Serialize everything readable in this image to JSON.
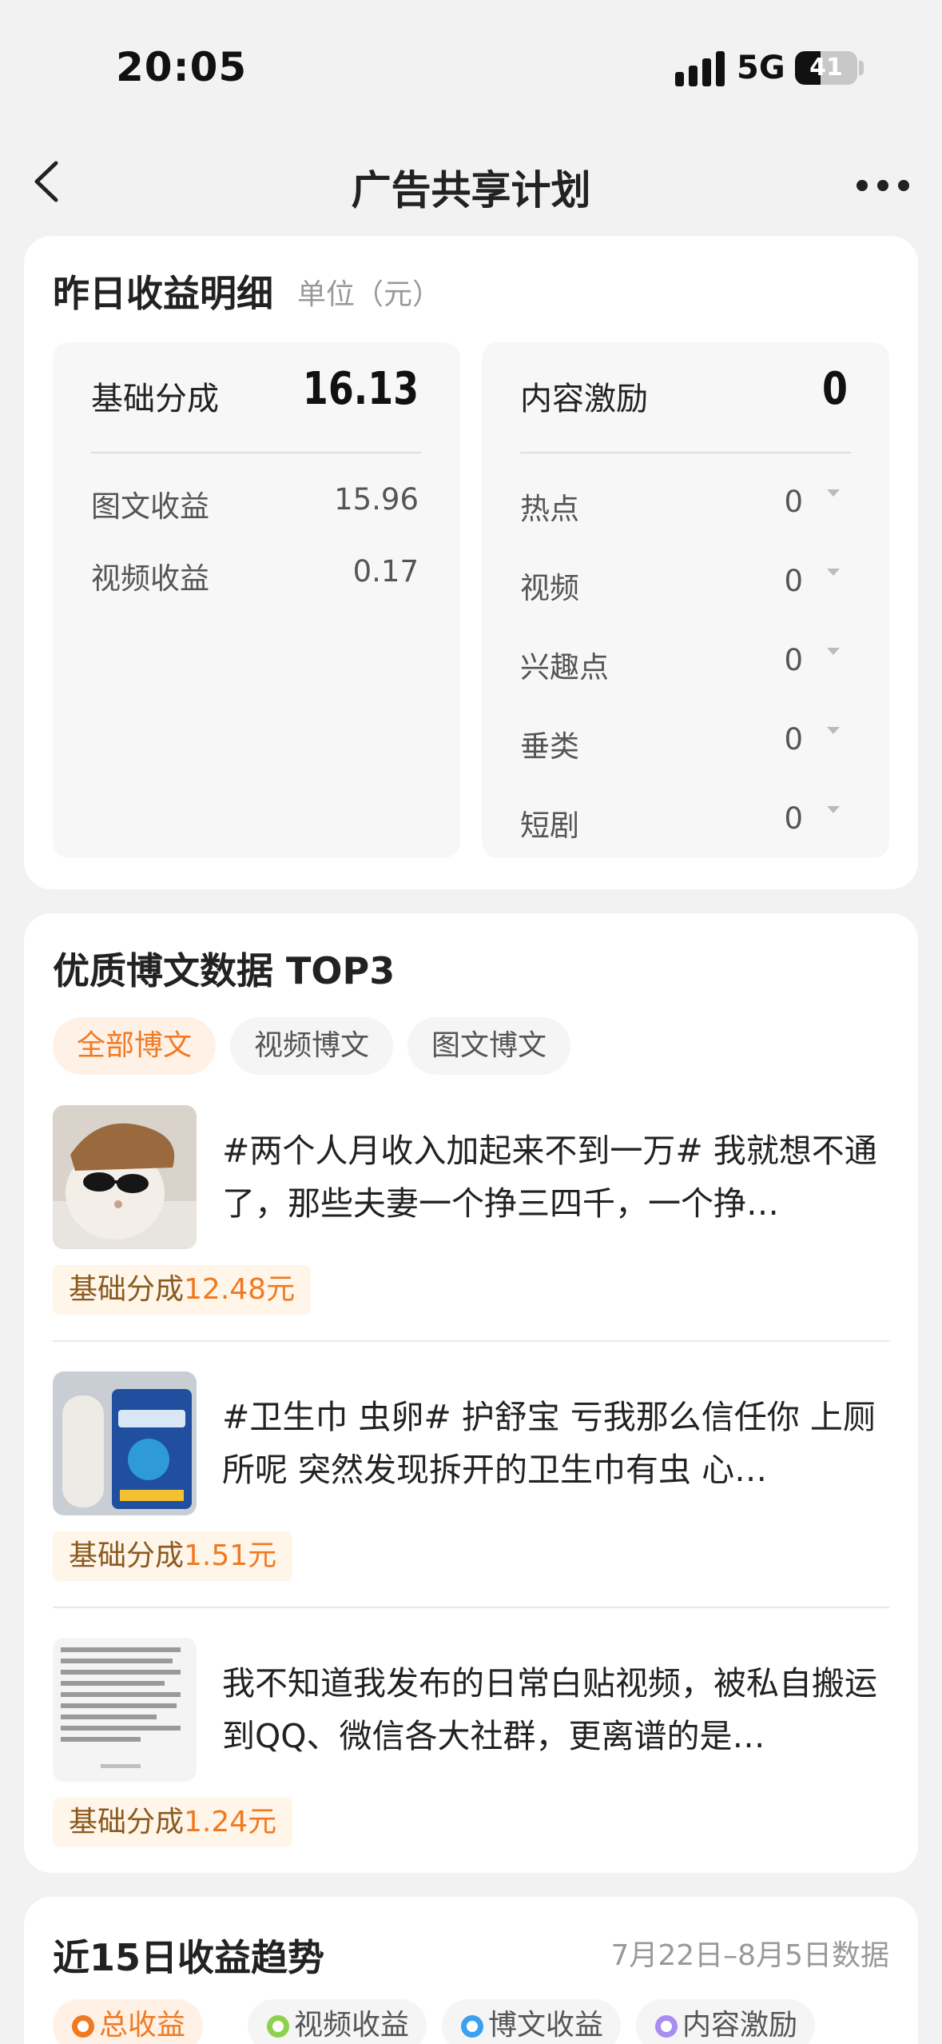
{
  "status_bar": {
    "time": "20:05",
    "network": "5G",
    "battery": "41",
    "battery_level": 0.41
  },
  "nav": {
    "title": "广告共享计划"
  },
  "earnings": {
    "title": "昨日收益明细",
    "unit": "单位（元）",
    "basic": {
      "label": "基础分成",
      "value": "16.13",
      "rows": [
        {
          "label": "图文收益",
          "value": "15.96"
        },
        {
          "label": "视频收益",
          "value": "0.17"
        }
      ]
    },
    "incentive": {
      "label": "内容激励",
      "value": "0",
      "rows": [
        {
          "label": "热点",
          "value": "0"
        },
        {
          "label": "视频",
          "value": "0"
        },
        {
          "label": "兴趣点",
          "value": "0"
        },
        {
          "label": "垂类",
          "value": "0"
        },
        {
          "label": "短剧",
          "value": "0"
        }
      ]
    }
  },
  "top_posts": {
    "title": "优质博文数据 TOP3",
    "tabs": [
      "全部博文",
      "视频博文",
      "图文博文"
    ],
    "active_tab": 0,
    "items": [
      {
        "text": "#两个人月收入加起来不到一万# 我就想不通了，那些夫妻一个挣三四千，一个挣…",
        "badge_label": "基础分成",
        "badge_amount": "12.48元"
      },
      {
        "text": "#卫生巾 虫卵# 护舒宝 亏我那么信任你 上厕所呢 突然发现拆开的卫生巾有虫 心…",
        "badge_label": "基础分成",
        "badge_amount": "1.51元"
      },
      {
        "text": "我不知道我发布的日常白贴视频，被私自搬运到QQ、微信各大社群，更离谱的是…",
        "badge_label": "基础分成",
        "badge_amount": "1.24元"
      }
    ]
  },
  "trend": {
    "title": "近15日收益趋势",
    "date_range": "7月22日–8月5日数据",
    "legends": [
      {
        "label": "总收益",
        "color": "#f07a22"
      },
      {
        "label": "视频收益",
        "color": "#8fd14f"
      },
      {
        "label": "博文收益",
        "color": "#3aa0f0"
      },
      {
        "label": "内容激励",
        "color": "#a98cf0"
      }
    ],
    "active_legend": 0
  }
}
